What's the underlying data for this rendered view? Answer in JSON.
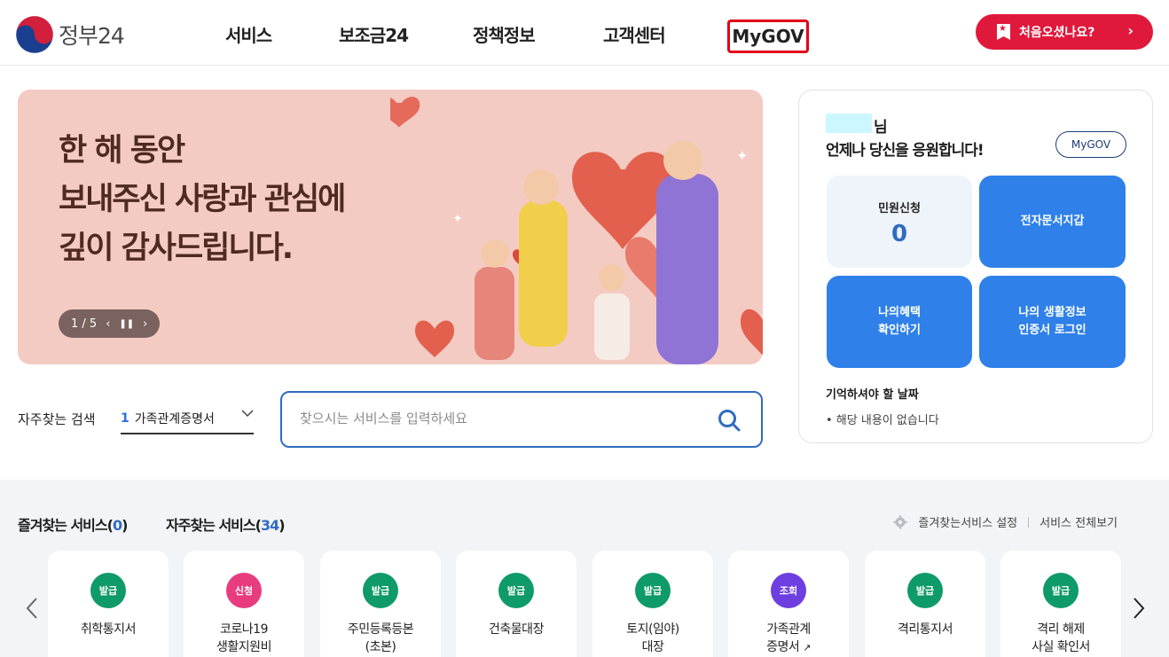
{
  "header": {
    "logo_text": "정부24",
    "nav": [
      {
        "label": "서비스"
      },
      {
        "label": "보조금24"
      },
      {
        "label": "정책정보"
      },
      {
        "label": "고객센터"
      }
    ],
    "mygov_label": "MyGOV",
    "cta_label": "처음오셨나요?"
  },
  "banner": {
    "lines": [
      "한 해 동안",
      "보내주신 사랑과 관심에",
      "깊이 감사드립니다."
    ],
    "pager": "1 / 5"
  },
  "search": {
    "label": "자주찾는 검색",
    "rank": "1",
    "keyword": "가족관계증명서",
    "placeholder": "찾으시는 서비스를 입력하세요"
  },
  "side": {
    "user_suffix": "님",
    "greeting": "언제나 당신을 응원합니다!",
    "mygov_button": "MyGOV",
    "tiles": [
      {
        "label": "민원신청",
        "count": "0"
      },
      {
        "label": "전자문서지갑"
      },
      {
        "line1": "나의혜택",
        "line2": "확인하기"
      },
      {
        "line1": "나의 생활정보",
        "line2": "인증서 로그인"
      }
    ],
    "remember_title": "기억하셔야 할 날짜",
    "remember_item": "• 해당 내용이 없습니다"
  },
  "favorites": {
    "fav_label": "즐겨찾는 서비스(",
    "fav_count": "0",
    "freq_label": "자주찾는 서비스(",
    "freq_count": "34",
    "close": ")",
    "settings": "즐겨찾는서비스 설정",
    "view_all": "서비스 전체보기",
    "cards": [
      {
        "badge": "발급",
        "line1": "취학통지서",
        "line2": ""
      },
      {
        "badge": "신청",
        "line1": "코로나19",
        "line2": "생활지원비"
      },
      {
        "badge": "발급",
        "line1": "주민등록등본",
        "line2": "(초본)"
      },
      {
        "badge": "발급",
        "line1": "건축물대장",
        "line2": ""
      },
      {
        "badge": "발급",
        "line1": "토지(임야)",
        "line2": "대장"
      },
      {
        "badge": "조회",
        "line1": "가족관계",
        "line2": "증명서"
      },
      {
        "badge": "발급",
        "line1": "격리통지서",
        "line2": ""
      },
      {
        "badge": "발급",
        "line1": "격리 해제",
        "line2": "사실 확인서"
      }
    ]
  },
  "colors": {
    "primary_blue": "#2f80e8",
    "cta_red": "#e0193c",
    "badge_green": "#0f9a6a",
    "badge_pink": "#e83c7f",
    "badge_purple": "#6e3fe0"
  }
}
